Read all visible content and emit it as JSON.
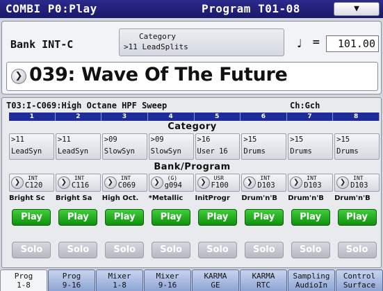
{
  "titlebar": {
    "mode": "COMBI P0:Play",
    "range": "Program T01-08",
    "menu_icon": "chevron-down-icon"
  },
  "header": {
    "bank": "Bank  INT-C",
    "category_title": "Category",
    "category_value": ">11 LeadSplits",
    "tempo_symbol": "♩",
    "tempo_eq": "=",
    "tempo": "101.00",
    "combi_name": "039: Wave Of The Future",
    "name_button_icon": "chevron-right-icon"
  },
  "main": {
    "timbre_info": "T03:I-C069:High Octane HPF Sweep",
    "channel": "Ch:Gch",
    "timbre_numbers": [
      "1",
      "2",
      "3",
      "4",
      "5",
      "6",
      "7",
      "8"
    ],
    "category_label": "Category",
    "bank_program_label": "Bank/Program",
    "categories": [
      {
        "num": ">11",
        "name": "LeadSyn"
      },
      {
        "num": ">11",
        "name": "LeadSyn"
      },
      {
        "num": ">09",
        "name": "SlowSyn"
      },
      {
        "num": ">09",
        "name": "SlowSyn"
      },
      {
        "num": ">16",
        "name": "User 16"
      },
      {
        "num": ">15",
        "name": "Drums"
      },
      {
        "num": ">15",
        "name": "Drums"
      },
      {
        "num": ">15",
        "name": "Drums"
      }
    ],
    "programs": [
      {
        "bank": "INT",
        "num": "C120"
      },
      {
        "bank": "INT",
        "num": "C116"
      },
      {
        "bank": "INT",
        "num": "C069"
      },
      {
        "bank": "(G)",
        "num": "g094"
      },
      {
        "bank": "USR",
        "num": "F100"
      },
      {
        "bank": "INT",
        "num": "D103"
      },
      {
        "bank": "INT",
        "num": "D103"
      },
      {
        "bank": "INT",
        "num": "D103"
      }
    ],
    "program_names": [
      "Bright Sc",
      "Bright Sa",
      "High Oct.",
      "*Metallic",
      "InitProgr",
      "Drum'n'B",
      "Drum'n'B",
      "Drum'n'B"
    ],
    "play_label": "Play",
    "solo_label": "Solo"
  },
  "tabs": [
    {
      "line1": "Prog",
      "line2": "1-8",
      "active": true
    },
    {
      "line1": "Prog",
      "line2": "9-16",
      "active": false
    },
    {
      "line1": "Mixer",
      "line2": "1-8",
      "active": false
    },
    {
      "line1": "Mixer",
      "line2": "9-16",
      "active": false
    },
    {
      "line1": "KARMA",
      "line2": "GE",
      "active": false
    },
    {
      "line1": "KARMA",
      "line2": "RTC",
      "active": false
    },
    {
      "line1": "Sampling",
      "line2": "AudioIn",
      "active": false
    },
    {
      "line1": "Control",
      "line2": "Surface",
      "active": false
    }
  ]
}
